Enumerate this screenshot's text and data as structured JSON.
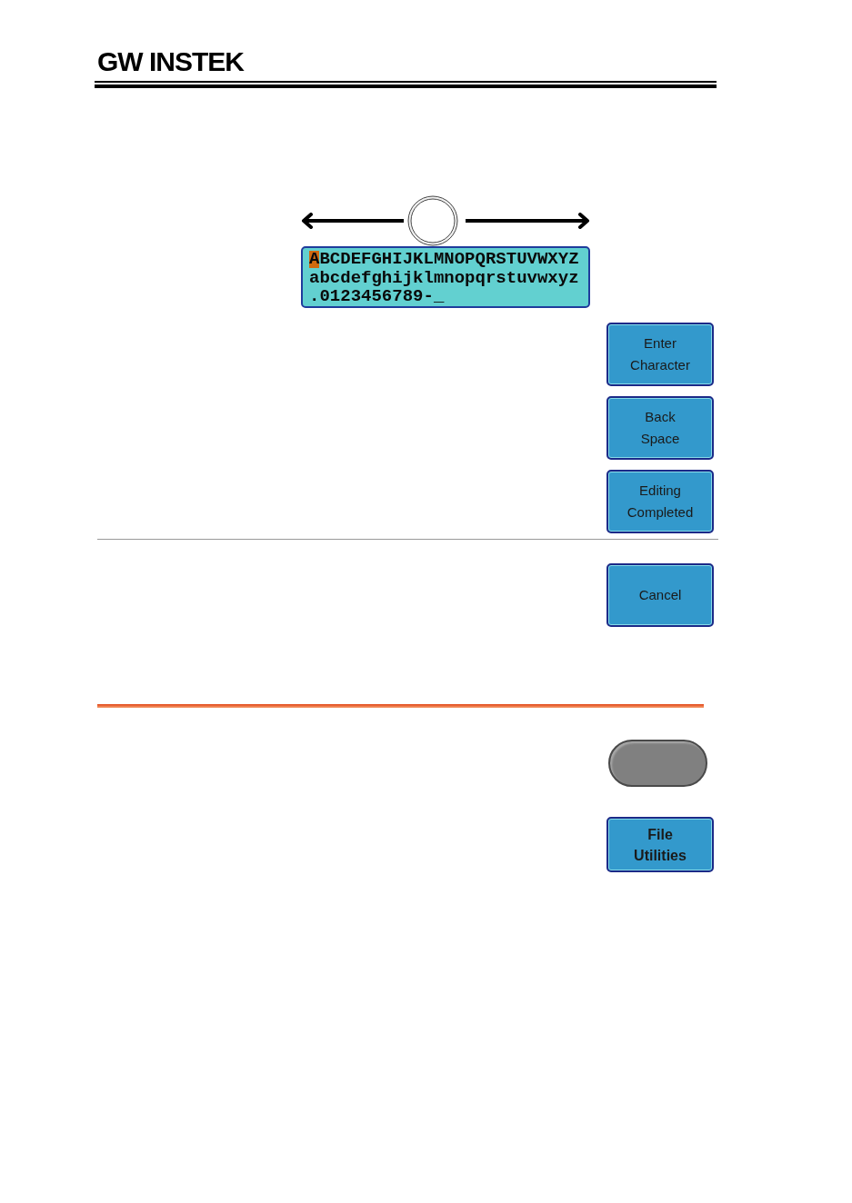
{
  "header": {
    "logo": "GW INSTEK"
  },
  "character_panel": {
    "rows": [
      {
        "characters": [
          {
            "char": "A",
            "selected": true
          },
          {
            "char": "B",
            "selected": false
          },
          {
            "char": "C",
            "selected": false
          },
          {
            "char": "D",
            "selected": false
          },
          {
            "char": "E",
            "selected": false
          },
          {
            "char": "F",
            "selected": false
          },
          {
            "char": "G",
            "selected": false
          },
          {
            "char": "H",
            "selected": false
          },
          {
            "char": "I",
            "selected": false
          },
          {
            "char": "J",
            "selected": false
          },
          {
            "char": "K",
            "selected": false
          },
          {
            "char": "L",
            "selected": false
          },
          {
            "char": "M",
            "selected": false
          },
          {
            "char": "N",
            "selected": false
          },
          {
            "char": "O",
            "selected": false
          },
          {
            "char": "P",
            "selected": false
          },
          {
            "char": "Q",
            "selected": false
          },
          {
            "char": "R",
            "selected": false
          },
          {
            "char": "S",
            "selected": false
          },
          {
            "char": "T",
            "selected": false
          },
          {
            "char": "U",
            "selected": false
          },
          {
            "char": "V",
            "selected": false
          },
          {
            "char": "W",
            "selected": false
          },
          {
            "char": "X",
            "selected": false
          },
          {
            "char": "Y",
            "selected": false
          },
          {
            "char": "Z",
            "selected": false
          }
        ]
      },
      {
        "characters": [
          {
            "char": "a",
            "selected": false
          },
          {
            "char": "b",
            "selected": false
          },
          {
            "char": "c",
            "selected": false
          },
          {
            "char": "d",
            "selected": false
          },
          {
            "char": "e",
            "selected": false
          },
          {
            "char": "f",
            "selected": false
          },
          {
            "char": "g",
            "selected": false
          },
          {
            "char": "h",
            "selected": false
          },
          {
            "char": "i",
            "selected": false
          },
          {
            "char": "j",
            "selected": false
          },
          {
            "char": "k",
            "selected": false
          },
          {
            "char": "l",
            "selected": false
          },
          {
            "char": "m",
            "selected": false
          },
          {
            "char": "n",
            "selected": false
          },
          {
            "char": "o",
            "selected": false
          },
          {
            "char": "p",
            "selected": false
          },
          {
            "char": "q",
            "selected": false
          },
          {
            "char": "r",
            "selected": false
          },
          {
            "char": "s",
            "selected": false
          },
          {
            "char": "t",
            "selected": false
          },
          {
            "char": "u",
            "selected": false
          },
          {
            "char": "v",
            "selected": false
          },
          {
            "char": "w",
            "selected": false
          },
          {
            "char": "x",
            "selected": false
          },
          {
            "char": "y",
            "selected": false
          },
          {
            "char": "z",
            "selected": false
          }
        ]
      },
      {
        "characters": [
          {
            "char": ".",
            "selected": false
          },
          {
            "char": "0",
            "selected": false
          },
          {
            "char": "1",
            "selected": false
          },
          {
            "char": "2",
            "selected": false
          },
          {
            "char": "3",
            "selected": false
          },
          {
            "char": "4",
            "selected": false
          },
          {
            "char": "5",
            "selected": false
          },
          {
            "char": "6",
            "selected": false
          },
          {
            "char": "7",
            "selected": false
          },
          {
            "char": "8",
            "selected": false
          },
          {
            "char": "9",
            "selected": false
          },
          {
            "char": "-",
            "selected": false
          },
          {
            "char": "_",
            "selected": false
          }
        ]
      }
    ]
  },
  "softkeys": [
    {
      "label": "Enter Character"
    },
    {
      "label": "Back Space"
    },
    {
      "label": "Editing Completed"
    }
  ],
  "cancel_key": {
    "label": "Cancel"
  },
  "file_utilities_key": {
    "label": "File Utilities"
  }
}
